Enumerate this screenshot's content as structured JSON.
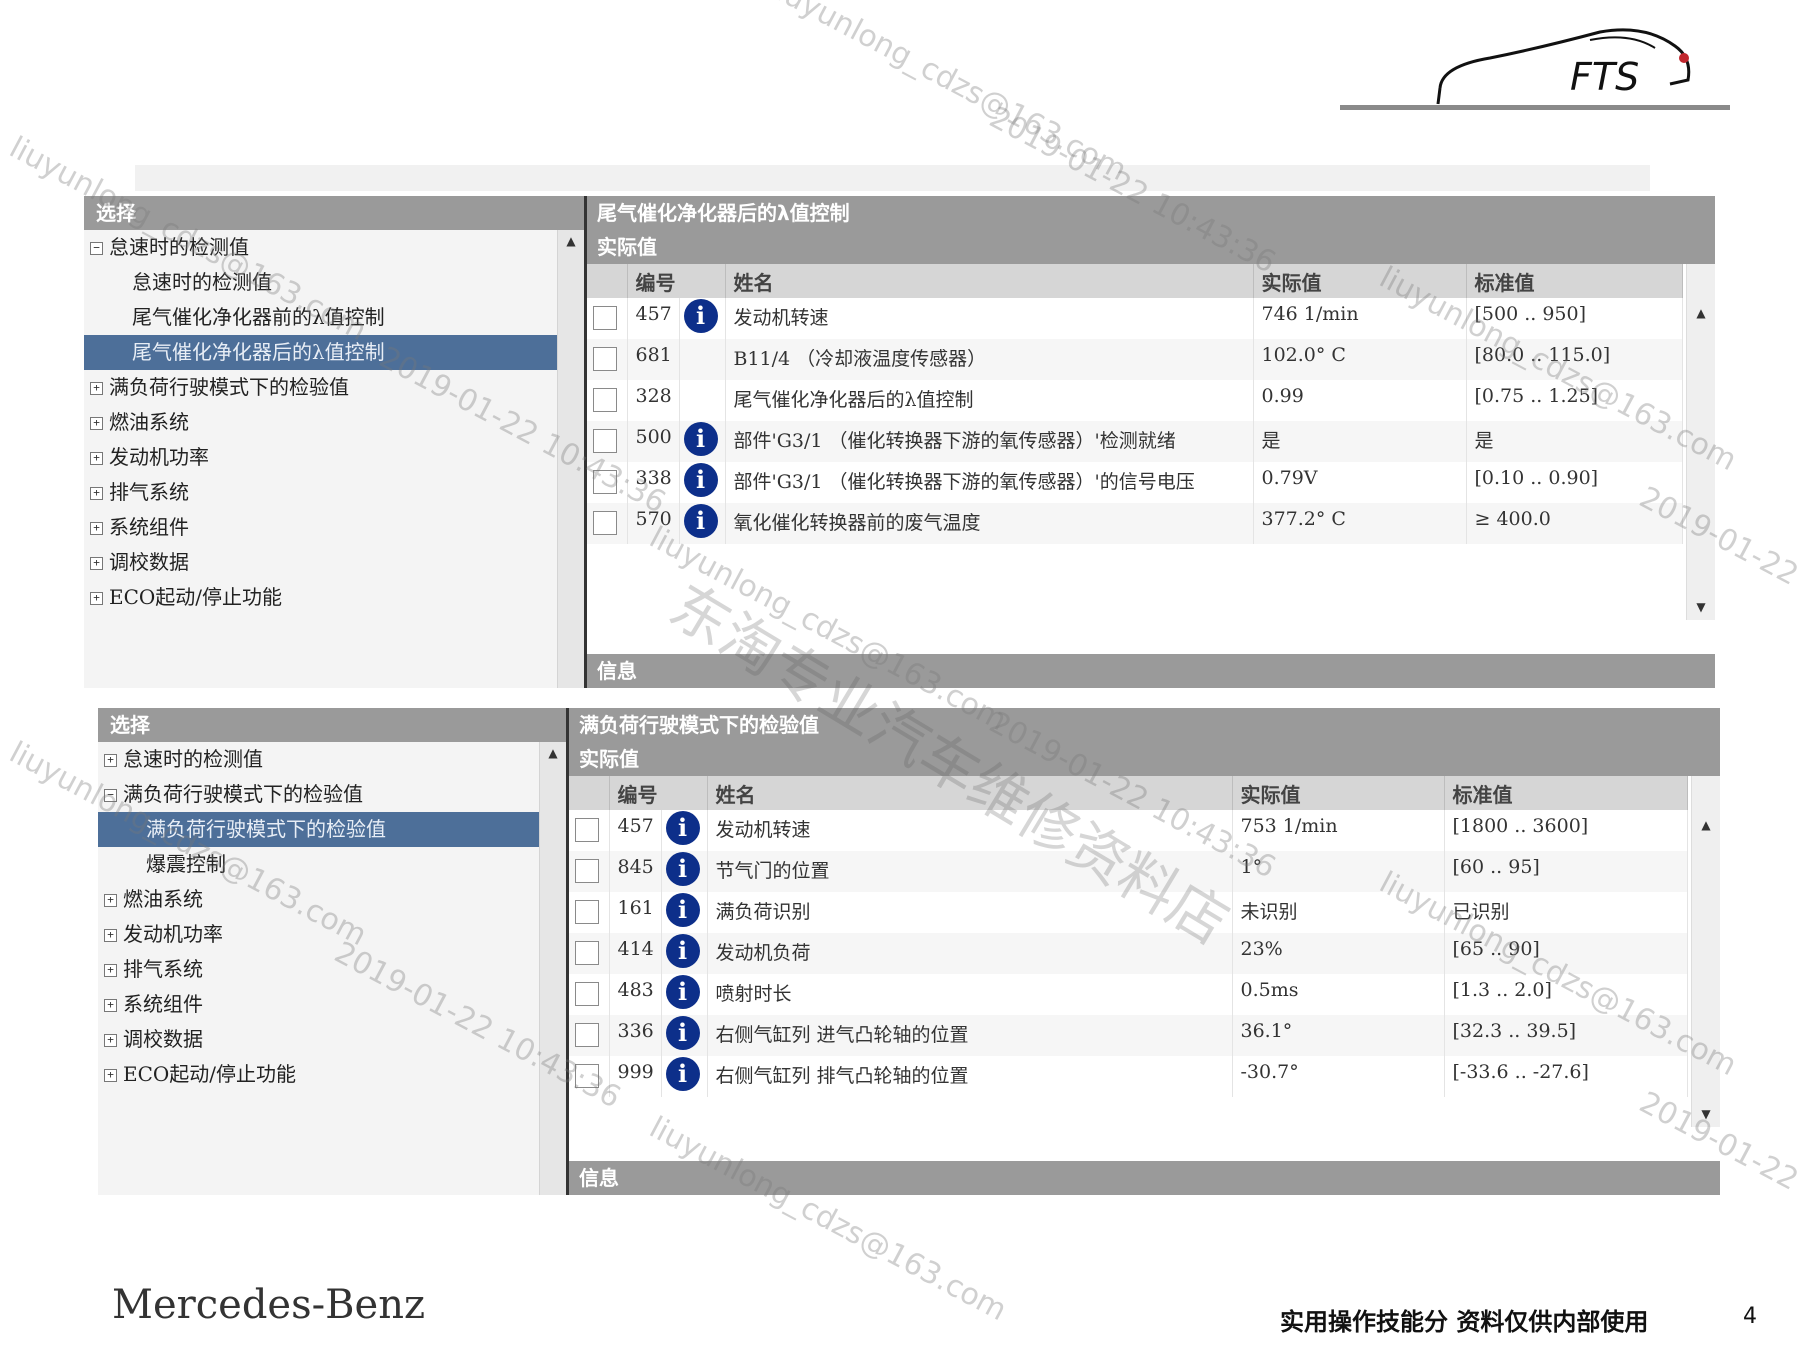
{
  "logo": {
    "text": "FTS"
  },
  "top_panel": {
    "left_header": "选择",
    "tree": [
      {
        "label": "怠速时的检测值",
        "expander": "⊟",
        "level": 1,
        "selected": false
      },
      {
        "label": "怠速时的检测值",
        "expander": "",
        "level": 2,
        "selected": false
      },
      {
        "label": "尾气催化净化器前的λ值控制",
        "expander": "",
        "level": 2,
        "selected": false
      },
      {
        "label": "尾气催化净化器后的λ值控制",
        "expander": "",
        "level": 2,
        "selected": true
      },
      {
        "label": "满负荷行驶模式下的检验值",
        "expander": "⊞",
        "level": 1,
        "selected": false
      },
      {
        "label": "燃油系统",
        "expander": "⊞",
        "level": 1,
        "selected": false
      },
      {
        "label": "发动机功率",
        "expander": "⊞",
        "level": 1,
        "selected": false
      },
      {
        "label": "排气系统",
        "expander": "⊞",
        "level": 1,
        "selected": false
      },
      {
        "label": "系统组件",
        "expander": "⊞",
        "level": 1,
        "selected": false
      },
      {
        "label": "调校数据",
        "expander": "⊞",
        "level": 1,
        "selected": false
      },
      {
        "label": "ECO起动/停止功能",
        "expander": "⊞",
        "level": 1,
        "selected": false
      }
    ],
    "title": "尾气催化净化器后的λ值控制",
    "subtitle": "实际值",
    "columns": {
      "no": "编号",
      "name": "姓名",
      "actual": "实际值",
      "standard": "标准值"
    },
    "rows": [
      {
        "no": "457",
        "info": true,
        "name": "发动机转速",
        "actual": "746 1/min",
        "actual_color": "green",
        "standard": "[500 .. 950]"
      },
      {
        "no": "681",
        "info": false,
        "name": "B11/4 （冷却液温度传感器）",
        "actual": "102.0° C",
        "actual_color": "green",
        "standard": "[80.0 .. 115.0]"
      },
      {
        "no": "328",
        "info": false,
        "name": "尾气催化净化器后的λ值控制",
        "actual": "0.99",
        "actual_color": "green",
        "standard": "[0.75 .. 1.25]"
      },
      {
        "no": "500",
        "info": true,
        "name": "部件'G3/1 （催化转换器下游的氧传感器）'检测就绪",
        "actual": "是",
        "actual_color": "green",
        "standard": "是"
      },
      {
        "no": "338",
        "info": true,
        "name": "部件'G3/1 （催化转换器下游的氧传感器）'的信号电压",
        "actual": "0.79V",
        "actual_color": "green",
        "standard": "[0.10 .. 0.90]"
      },
      {
        "no": "570",
        "info": true,
        "name": "氧化催化转换器前的废气温度",
        "actual": "377.2° C",
        "actual_color": "red",
        "standard": "≥ 400.0"
      }
    ],
    "info_label": "信息"
  },
  "bottom_panel": {
    "left_header": "选择",
    "tree": [
      {
        "label": "怠速时的检测值",
        "expander": "⊞",
        "level": 1,
        "selected": false
      },
      {
        "label": "满负荷行驶模式下的检验值",
        "expander": "⊟",
        "level": 1,
        "selected": false
      },
      {
        "label": "满负荷行驶模式下的检验值",
        "expander": "",
        "level": 2,
        "selected": true
      },
      {
        "label": "爆震控制",
        "expander": "",
        "level": 2,
        "selected": false
      },
      {
        "label": "燃油系统",
        "expander": "⊞",
        "level": 1,
        "selected": false
      },
      {
        "label": "发动机功率",
        "expander": "⊞",
        "level": 1,
        "selected": false
      },
      {
        "label": "排气系统",
        "expander": "⊞",
        "level": 1,
        "selected": false
      },
      {
        "label": "系统组件",
        "expander": "⊞",
        "level": 1,
        "selected": false
      },
      {
        "label": "调校数据",
        "expander": "⊞",
        "level": 1,
        "selected": false
      },
      {
        "label": "ECO起动/停止功能",
        "expander": "⊞",
        "level": 1,
        "selected": false
      }
    ],
    "title": "满负荷行驶模式下的检验值",
    "subtitle": "实际值",
    "columns": {
      "no": "编号",
      "name": "姓名",
      "actual": "实际值",
      "standard": "标准值"
    },
    "rows": [
      {
        "no": "457",
        "info": true,
        "name": "发动机转速",
        "actual": "753 1/min",
        "actual_color": "red",
        "standard": "[1800 .. 3600]"
      },
      {
        "no": "845",
        "info": true,
        "name": "节气门的位置",
        "actual": "1°",
        "actual_color": "red",
        "standard": "[60 .. 95]"
      },
      {
        "no": "161",
        "info": true,
        "name": "满负荷识别",
        "actual": "未识别",
        "actual_color": "red",
        "standard": "已识别"
      },
      {
        "no": "414",
        "info": true,
        "name": "发动机负荷",
        "actual": "23%",
        "actual_color": "red",
        "standard": "[65 .. 90]"
      },
      {
        "no": "483",
        "info": true,
        "name": "喷射时长",
        "actual": "0.5ms",
        "actual_color": "red",
        "standard": "[1.3 .. 2.0]"
      },
      {
        "no": "336",
        "info": true,
        "name": "右侧气缸列 进气凸轮轴的位置",
        "actual": "36.1°",
        "actual_color": "green",
        "standard": "[32.3 .. 39.5]"
      },
      {
        "no": "999",
        "info": true,
        "name": "右侧气缸列 排气凸轮轴的位置",
        "actual": "-30.7°",
        "actual_color": "green",
        "standard": "[-33.6 .. -27.6]"
      }
    ],
    "info_label": "信息"
  },
  "footer": {
    "brand": "Mercedes-Benz",
    "note": "实用操作技能分 资料仅供内部使用",
    "page_number": "4"
  },
  "watermarks": {
    "email": "liuyunlong_cdzs@163.com",
    "date": "2019-01-22 10:43:36",
    "shop": "东淘专业汽车维修资料店"
  },
  "colors": {
    "header_gray": "#9a9a9a",
    "selection_blue": "#4d6f99",
    "info_icon_blue": "#0d2f8a",
    "value_green": "#3c9a3c",
    "value_red": "#d44a4a"
  }
}
